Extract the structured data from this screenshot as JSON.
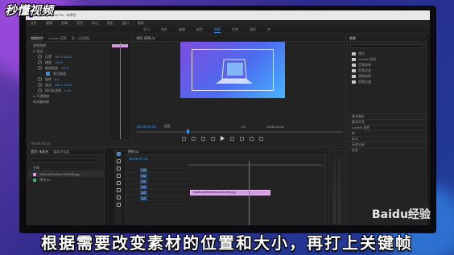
{
  "overlay": {
    "brand_text": "秒懂视频",
    "subtitle": "根据需要改变素材的位置和大小，再打上关键帧",
    "watermark": "Baidu经验"
  },
  "app": {
    "title": "Adobe Premiere Pro - 未命名",
    "menu": [
      "文件",
      "编辑",
      "剪辑",
      "序列",
      "标记",
      "图形",
      "窗口",
      "帮助"
    ],
    "workspaces": [
      "学习",
      "组件",
      "编辑",
      "颜色",
      "效果",
      "音频",
      "图形",
      "库"
    ],
    "active_workspace": "效果"
  },
  "effect_controls": {
    "tabs": [
      "效果控件",
      "Lumetri 范围",
      "源：(无剪辑)",
      "音频剪辑混合器"
    ],
    "rows": [
      {
        "label": "视频效果",
        "value": ""
      },
      {
        "label": "fx 运动",
        "value": ""
      },
      {
        "label": "位置",
        "value": "287.0  162.0"
      },
      {
        "label": "缩放",
        "value": "100.0"
      },
      {
        "label": "缩放宽度",
        "value": "100.0"
      },
      {
        "label": "等比缩放",
        "value": ""
      },
      {
        "label": "旋转",
        "value": "0.0"
      },
      {
        "label": "锚点",
        "value": "287.0  162.0"
      },
      {
        "label": "防闪烁滤镜",
        "value": "0.00"
      },
      {
        "label": "fx 不透明度",
        "value": ""
      },
      {
        "label": "时间重映射",
        "value": ""
      }
    ],
    "timecode": "00:00:04:10"
  },
  "program_monitor": {
    "tab": "节目: 序列 01",
    "timecode": "00:00:04:10",
    "fit": "适合",
    "quality": "1/2",
    "duration": "00:00:14:10"
  },
  "effects_panel": {
    "tab": "效果",
    "items": [
      "预设",
      "Lumetri 预设",
      "音频效果",
      "音频过渡",
      "视频效果",
      "视频过渡"
    ],
    "bottom_items": [
      "基本图形",
      "基本声音",
      "Lumetri 颜色",
      "库",
      "标记",
      "历史记录",
      "信息"
    ]
  },
  "project": {
    "tabs": [
      "项目: 未命名",
      "媒体浏览器"
    ],
    "name_header": "名称",
    "items": [
      {
        "name": "9bdfb-afc99ef3a4c1240ec9fa.jpg",
        "color": "#d39ae2"
      },
      {
        "name": "序列 01",
        "color": "#3fb27f"
      }
    ]
  },
  "timeline": {
    "tab": "序列 01",
    "timecode": "00:00:04:10",
    "tracks": [
      "V3",
      "V2",
      "V1",
      "A1",
      "A2",
      "A3"
    ],
    "clip_label": "9bdfb-afc99ef3a4c1240ec9fa.jpg"
  }
}
